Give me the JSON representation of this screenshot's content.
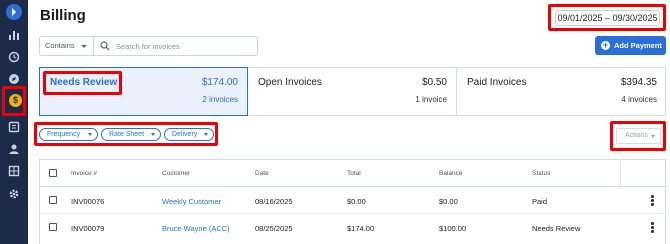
{
  "sidebar": {
    "items": [
      {
        "icon": "expand-icon"
      },
      {
        "icon": "bar-chart-icon"
      },
      {
        "icon": "history-icon"
      },
      {
        "icon": "compass-icon"
      },
      {
        "icon": "dollar-icon",
        "active": true
      },
      {
        "icon": "document-icon"
      },
      {
        "icon": "user-icon"
      },
      {
        "icon": "grid-icon"
      },
      {
        "icon": "gear-icon"
      }
    ]
  },
  "header": {
    "title": "Billing",
    "date_range": "09/01/2025 – 09/30/2025"
  },
  "search": {
    "mode": "Contains",
    "placeholder": "Search for invoices",
    "value": ""
  },
  "add_payment": {
    "label": "Add Payment"
  },
  "summary": {
    "cards": [
      {
        "label": "Needs Review",
        "amount": "$174.00",
        "sub": "2 invoices",
        "selected": true
      },
      {
        "label": "Open Invoices",
        "amount": "$0.50",
        "sub": "1 invoice"
      },
      {
        "label": "Paid Invoices",
        "amount": "$394.35",
        "sub": "4 invoices"
      }
    ]
  },
  "filters": [
    {
      "label": "Frequency"
    },
    {
      "label": "Rate Sheet"
    },
    {
      "label": "Delivery"
    }
  ],
  "actions": {
    "label": "Actions"
  },
  "table": {
    "columns": [
      "Invoice #",
      "Customer",
      "Date",
      "Total",
      "Balance",
      "Status"
    ],
    "rows": [
      {
        "invoice": "INV00076",
        "customer": "Weekly Customer",
        "date": "08/16/2025",
        "total": "$0.00",
        "balance": "$0.00",
        "status": "Paid"
      },
      {
        "invoice": "INV00079",
        "customer": "Bruce Wayne (ACC)",
        "date": "08/25/2025",
        "total": "$174.00",
        "balance": "$100.00",
        "status": "Needs Review"
      }
    ]
  },
  "colors": {
    "sidebar_bg": "#1c2b4a",
    "accent": "#2a6fd8",
    "highlight": "#e00000",
    "active_icon": "#f2b400"
  }
}
